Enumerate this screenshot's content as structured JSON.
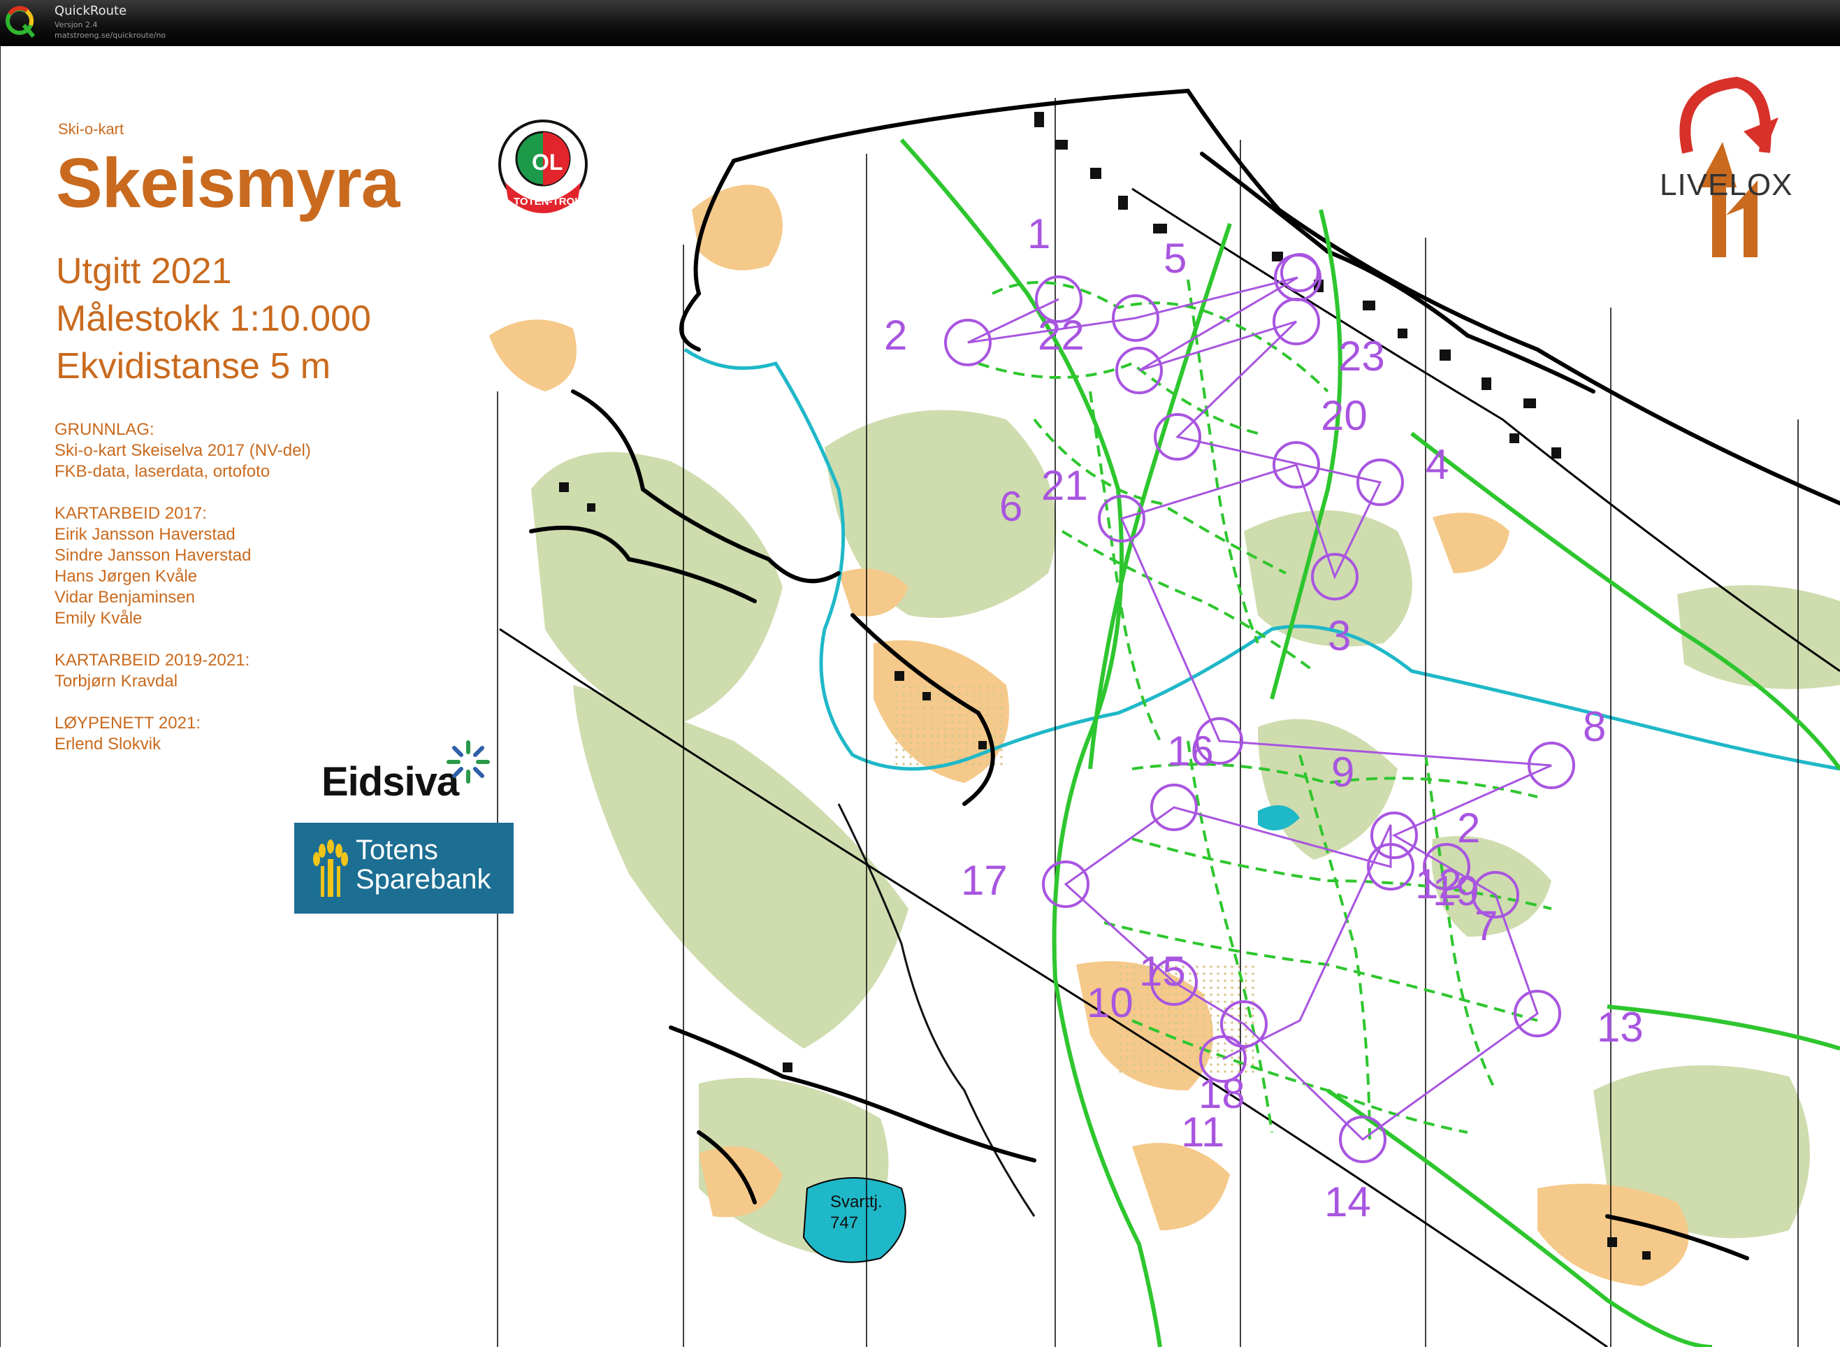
{
  "app": {
    "name": "QuickRoute",
    "version": "Versjon 2.4",
    "url": "matstroeng.se/quickroute/no"
  },
  "legend": {
    "kind": "Ski-o-kart",
    "map_name": "Skeismyra",
    "published": "Utgitt 2021",
    "scale": "Målestokk 1:10.000",
    "contour": "Ekvidistanse 5 m",
    "credits": [
      {
        "heading": "GRUNNLAG:",
        "lines": [
          "Ski-o-kart Skeiselva 2017 (NV-del)",
          "FKB-data, laserdata, ortofoto"
        ]
      },
      {
        "heading": "KARTARBEID 2017:",
        "lines": [
          "Eirik Jansson Haverstad",
          "Sindre Jansson Haverstad",
          "Hans Jørgen Kvåle",
          "Vidar Benjaminsen",
          "Emily Kvåle"
        ]
      },
      {
        "heading": "KARTARBEID 2019-2021:",
        "lines": [
          "Torbjørn Kravdal"
        ]
      },
      {
        "heading": "LØYPENETT 2021:",
        "lines": [
          "Erlend Slokvik"
        ]
      }
    ]
  },
  "club_logo": {
    "icon": "ol-toten-troll-logo",
    "text_top": "OL",
    "text_ring": "TOTEN-TROLL"
  },
  "sponsors": {
    "eidsiva": "Eidsiva",
    "totens_line1": "Totens",
    "totens_line2": "Sparebank"
  },
  "livelox": {
    "icon": "livelox-logo",
    "text": "LIVELOX"
  },
  "lake": {
    "name": "Svarttj.",
    "elevation": "747"
  },
  "controls": [
    {
      "label": "1"
    },
    {
      "label": "2"
    },
    {
      "label": "3"
    },
    {
      "label": "4"
    },
    {
      "label": "5"
    },
    {
      "label": "6"
    },
    {
      "label": "7"
    },
    {
      "label": "8"
    },
    {
      "label": "9"
    },
    {
      "label": "10"
    },
    {
      "label": "11"
    },
    {
      "label": "12"
    },
    {
      "label": "13"
    },
    {
      "label": "14"
    },
    {
      "label": "15"
    },
    {
      "label": "16"
    },
    {
      "label": "17"
    },
    {
      "label": "18"
    },
    {
      "label": "19"
    },
    {
      "label": "20"
    },
    {
      "label": "21"
    },
    {
      "label": "22"
    },
    {
      "label": "23"
    }
  ],
  "colors": {
    "course": "#a855e0",
    "ski_track": "#2ec62e",
    "open_land": "#f5c98a",
    "forest_slow": "#cfdcae",
    "water": "#1fb8c8",
    "legend_text": "#c96a1e"
  }
}
